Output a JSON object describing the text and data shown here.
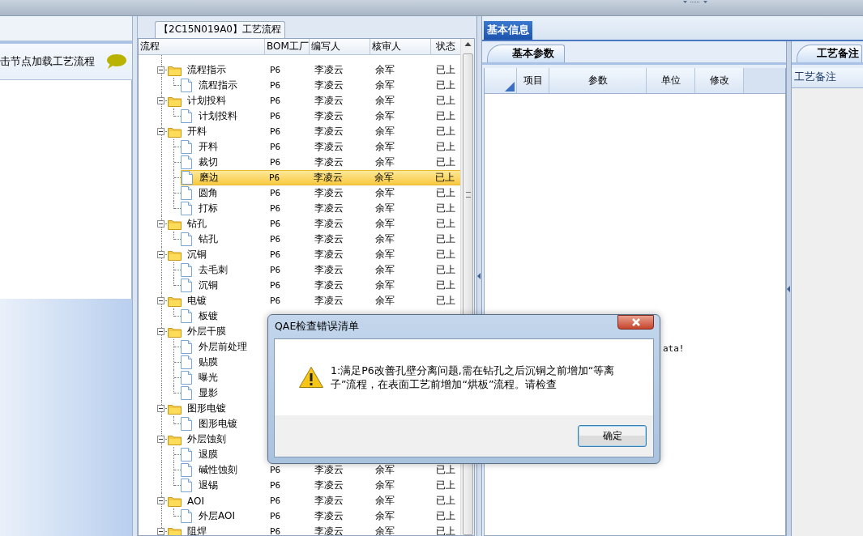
{
  "left_panel": {
    "hint": "击节点加载工艺流程"
  },
  "flow_panel": {
    "tab": "【2C15N019A0】工艺流程",
    "columns": [
      "流程",
      "BOM工厂",
      "编写人",
      "核审人",
      "状态"
    ],
    "rows": [
      {
        "label": "流程指示",
        "kind": "folder",
        "expanded": true,
        "selected": false,
        "bom": "P6",
        "author": "李凌云",
        "reviewer": "余军",
        "status": "已上",
        "children": [
          {
            "label": "流程指示",
            "kind": "page",
            "selected": false,
            "bom": "P6",
            "author": "李凌云",
            "reviewer": "余军",
            "status": "已上"
          }
        ]
      },
      {
        "label": "计划投料",
        "kind": "folder",
        "expanded": true,
        "selected": false,
        "bom": "P6",
        "author": "李凌云",
        "reviewer": "余军",
        "status": "已上",
        "children": [
          {
            "label": "计划投料",
            "kind": "page",
            "selected": false,
            "bom": "P6",
            "author": "李凌云",
            "reviewer": "余军",
            "status": "已上"
          }
        ]
      },
      {
        "label": "开料",
        "kind": "folder",
        "expanded": true,
        "selected": false,
        "bom": "P6",
        "author": "李凌云",
        "reviewer": "余军",
        "status": "已上",
        "children": [
          {
            "label": "开料",
            "kind": "page",
            "selected": false,
            "bom": "P6",
            "author": "李凌云",
            "reviewer": "余军",
            "status": "已上"
          },
          {
            "label": "裁切",
            "kind": "page",
            "selected": false,
            "bom": "P6",
            "author": "李凌云",
            "reviewer": "余军",
            "status": "已上"
          },
          {
            "label": "磨边",
            "kind": "page",
            "selected": true,
            "bom": "P6",
            "author": "李凌云",
            "reviewer": "余军",
            "status": "已上"
          },
          {
            "label": "圆角",
            "kind": "page",
            "selected": false,
            "bom": "P6",
            "author": "李凌云",
            "reviewer": "余军",
            "status": "已上"
          },
          {
            "label": "打标",
            "kind": "page",
            "selected": false,
            "bom": "P6",
            "author": "李凌云",
            "reviewer": "余军",
            "status": "已上"
          }
        ]
      },
      {
        "label": "钻孔",
        "kind": "folder",
        "expanded": true,
        "selected": false,
        "bom": "P6",
        "author": "李凌云",
        "reviewer": "余军",
        "status": "已上",
        "children": [
          {
            "label": "钻孔",
            "kind": "page",
            "selected": false,
            "bom": "P6",
            "author": "李凌云",
            "reviewer": "余军",
            "status": "已上"
          }
        ]
      },
      {
        "label": "沉铜",
        "kind": "folder",
        "expanded": true,
        "selected": false,
        "bom": "P6",
        "author": "李凌云",
        "reviewer": "余军",
        "status": "已上",
        "children": [
          {
            "label": "去毛刺",
            "kind": "page",
            "selected": false,
            "bom": "P6",
            "author": "李凌云",
            "reviewer": "余军",
            "status": "已上"
          },
          {
            "label": "沉铜",
            "kind": "page",
            "selected": false,
            "bom": "P6",
            "author": "李凌云",
            "reviewer": "余军",
            "status": "已上"
          }
        ]
      },
      {
        "label": "电镀",
        "kind": "folder",
        "expanded": true,
        "selected": false,
        "bom": "P6",
        "author": "李凌云",
        "reviewer": "余军",
        "status": "已上",
        "children": [
          {
            "label": "板镀",
            "kind": "page",
            "selected": false
          }
        ]
      },
      {
        "label": "外层干膜",
        "kind": "folder",
        "expanded": true,
        "selected": false,
        "children": [
          {
            "label": "外层前处理",
            "kind": "page",
            "selected": false
          },
          {
            "label": "贴膜",
            "kind": "page",
            "selected": false
          },
          {
            "label": "曝光",
            "kind": "page",
            "selected": false
          },
          {
            "label": "显影",
            "kind": "page",
            "selected": false
          }
        ]
      },
      {
        "label": "图形电镀",
        "kind": "folder",
        "expanded": true,
        "selected": false,
        "children": [
          {
            "label": "图形电镀",
            "kind": "page",
            "selected": false
          }
        ]
      },
      {
        "label": "外层蚀刻",
        "kind": "folder",
        "expanded": true,
        "selected": false,
        "children": [
          {
            "label": "退膜",
            "kind": "page",
            "selected": false
          },
          {
            "label": "碱性蚀刻",
            "kind": "page",
            "selected": false,
            "bom": "P6",
            "author": "李凌云",
            "reviewer": "余军",
            "status": "已上"
          },
          {
            "label": "退锡",
            "kind": "page",
            "selected": false,
            "bom": "P6",
            "author": "李凌云",
            "reviewer": "余军",
            "status": "已上"
          }
        ]
      },
      {
        "label": "AOI",
        "kind": "folder",
        "expanded": true,
        "selected": false,
        "bom": "P6",
        "author": "李凌云",
        "reviewer": "余军",
        "status": "已上",
        "children": [
          {
            "label": "外层AOI",
            "kind": "page",
            "selected": false,
            "bom": "P6",
            "author": "李凌云",
            "reviewer": "余军",
            "status": "已上"
          }
        ]
      },
      {
        "label": "阻焊",
        "kind": "folder",
        "expanded": true,
        "selected": false,
        "bom": "P6",
        "author": "李凌云",
        "reviewer": "余军",
        "status": "已上"
      }
    ]
  },
  "info_panel": {
    "tab": "基本信息",
    "params_tab": "基本参数",
    "params_columns": [
      "项目",
      "参数",
      "单位",
      "修改"
    ],
    "params_empty": "ata!",
    "notes_tab": "工艺备注",
    "notes_column": "工艺备注"
  },
  "dialog": {
    "title": "QAE检查错误清单",
    "message": "1:满足P6改善孔壁分离问题,需在钻孔之后沉铜之前增加“等离子”流程，在表面工艺前增加“烘板”流程。请检查",
    "ok": "确定"
  }
}
